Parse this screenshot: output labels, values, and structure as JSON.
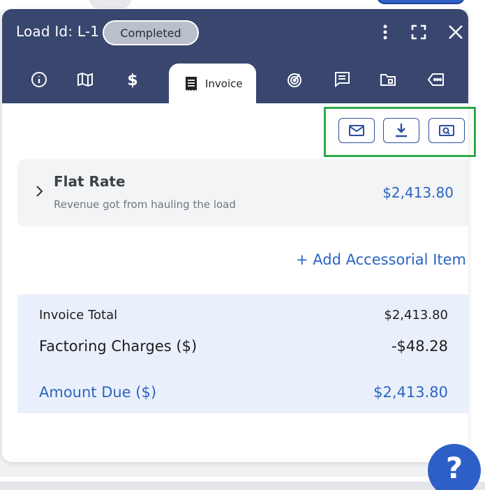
{
  "header": {
    "title": "Load Id: L-1",
    "status": "Completed"
  },
  "tabs": [
    {
      "name": "info",
      "icon": "info-icon"
    },
    {
      "name": "map",
      "icon": "map-icon"
    },
    {
      "name": "rates",
      "icon": "dollar-icon"
    },
    {
      "name": "invoice",
      "icon": "receipt-icon",
      "label": "Invoice",
      "active": true
    },
    {
      "name": "tracking",
      "icon": "radar-icon"
    },
    {
      "name": "notes",
      "icon": "chat-list-icon"
    },
    {
      "name": "documents",
      "icon": "folder-icon"
    },
    {
      "name": "tags",
      "icon": "tag-icon"
    }
  ],
  "actions": [
    "mail-icon",
    "download-icon",
    "preview-icon"
  ],
  "flat_rate": {
    "title": "Flat Rate",
    "subtitle": "Revenue got from hauling the load",
    "amount": "$2,413.80"
  },
  "add_item": "+ Add Accessorial Item",
  "totals": {
    "invoice_total_label": "Invoice Total",
    "invoice_total_value": "$2,413.80",
    "factoring_label": "Factoring Charges ($)",
    "factoring_value": "-$48.28",
    "amount_due_label": "Amount Due ($)",
    "amount_due_value": "$2,413.80"
  },
  "help": "?",
  "colors": {
    "header_bg": "#39476f",
    "accent_blue": "#2b64c2",
    "highlight_green": "#2faa4a"
  }
}
